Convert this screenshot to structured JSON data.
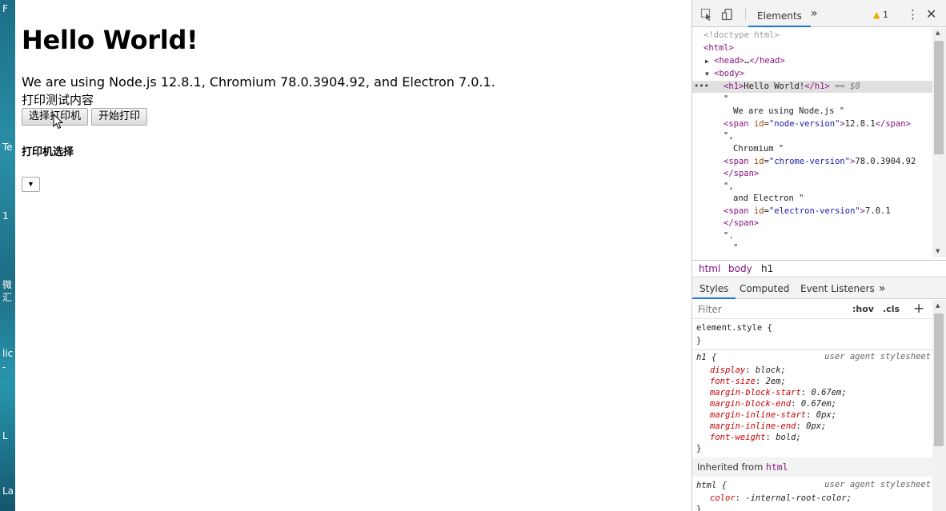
{
  "desktop": {
    "labels": [
      "F",
      "Te",
      "1",
      "微",
      "汇",
      "lic",
      "-",
      "L",
      "La"
    ]
  },
  "page": {
    "heading": "Hello World!",
    "intro_prefix": "We are using Node.js ",
    "node_version": "12.8.1",
    "intro_mid1": ", Chromium ",
    "chrome_version": "78.0.3904.92",
    "intro_mid2": ", and Electron ",
    "electron_version": "7.0.1",
    "intro_suffix": ".",
    "print_content": "打印测试内容",
    "select_printer_button": "选择打印机",
    "start_print_button": "开始打印",
    "printer_select_title": "打印机选择",
    "printer_select_arrow": "▼"
  },
  "devtools": {
    "toolbar": {
      "tab_elements": "Elements",
      "more_tabs": "»",
      "warning_count": "1",
      "menu_icon": "⋮",
      "close_icon": "✕"
    },
    "dom": {
      "doctype": "<!doctype html>",
      "html_open": "<html>",
      "head_open": "<head>",
      "head_ellipsis": "…",
      "head_close": "</head>",
      "body_open": "<body>",
      "h1_open": "<h1>",
      "h1_text": "Hello World!",
      "h1_close": "</h1>",
      "selected_marker": "== $0",
      "row_dots": "•••",
      "quote_open": "\"",
      "text1": "We are using Node.js \"",
      "span_tag": "<span",
      "attr_id": "id",
      "node_id": "\"node-version\"",
      "node_val": "12.8.1",
      "span_close": "</span>",
      "text2_a": "\",",
      "text2_b": "Chromium \"",
      "chrome_id": "\"chrome-version\"",
      "chrome_val": "78.0.3904.92",
      "text3_a": "\",",
      "text3_b": "and Electron \"",
      "electron_id": "\"electron-version\"",
      "electron_val": "7.0.1",
      "text4_a": "\".",
      "text4_b": "\""
    },
    "breadcrumbs": [
      "html",
      "body",
      "h1"
    ],
    "style_tabs": [
      "Styles",
      "Computed",
      "Event Listeners",
      "»"
    ],
    "filter_placeholder": "Filter",
    "hov": ":hov",
    "cls": ".cls",
    "plus": "+",
    "styles": {
      "element_style": "element.style {",
      "close_brace": "}",
      "h1_selector": "h1 {",
      "ua_label": "user agent stylesheet",
      "h1_props": [
        {
          "name": "display",
          "value": "block;"
        },
        {
          "name": "font-size",
          "value": "2em;"
        },
        {
          "name": "margin-block-start",
          "value": "0.67em;"
        },
        {
          "name": "margin-block-end",
          "value": "0.67em;"
        },
        {
          "name": "margin-inline-start",
          "value": "0px;"
        },
        {
          "name": "margin-inline-end",
          "value": "0px;"
        },
        {
          "name": "font-weight",
          "value": "bold;"
        }
      ],
      "inherited_label": "Inherited from ",
      "inherited_tag": "html",
      "html_selector": "html {",
      "html_props": [
        {
          "name": "color",
          "value": "-internal-root-color;"
        }
      ]
    }
  }
}
